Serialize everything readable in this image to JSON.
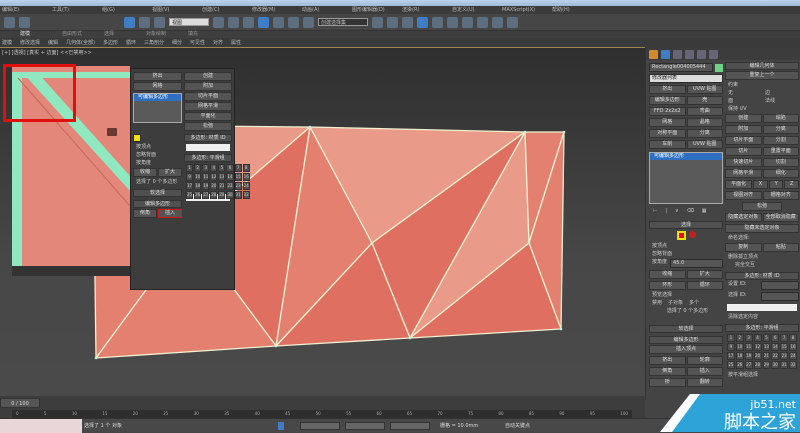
{
  "menu": [
    "编辑(E)",
    "工具(T)",
    "组(G)",
    "视图(V)",
    "创建(C)",
    "修改器(M)",
    "动画(A)",
    "图形编辑器(D)",
    "渲染(R)",
    "自定义(U)",
    "MAXScript(X)",
    "帮助(H)"
  ],
  "toolbar": {
    "view_select": "视图",
    "selection_set": "创建选择集"
  },
  "ribbon_tabs": [
    "建模",
    "自由形式",
    "选择",
    "对象绘制",
    "填充"
  ],
  "ribbon_items": [
    "建模",
    "修改选择",
    "编辑",
    "几何体(全部)",
    "多边形",
    "循环",
    "三角剖分",
    "细分",
    "可见性",
    "对齐",
    "属性"
  ],
  "viewport_label": "[+] [透视] [真实 + 边面] <<已禁用>>",
  "command_panel": {
    "object_name": "Rectangle004005444",
    "object_color": "#6fd08a",
    "modifier_list": "修改器列表",
    "left_buttons": [
      "挤出",
      "UVW 贴图",
      "编辑多边形",
      "壳",
      "FFD 2x2x2",
      "弯曲",
      "网格",
      "晶格",
      "对称平面",
      "分离",
      "车削",
      "UVW 贴图"
    ],
    "stack_item": "可编辑多边形",
    "selection_header": "选择",
    "selection_options": [
      "按顶点",
      "忽略背面",
      "按角度"
    ],
    "angle_value": "45.0",
    "shrink": "收缩",
    "grow": "扩大",
    "ring": "环形",
    "loop": "循环",
    "preview_label": "预览选择",
    "preview_options": [
      "禁用",
      "子对象",
      "多个"
    ],
    "selection_status": "选择了 0 个多边形",
    "soft_selection": "软选择",
    "edit_polygons": "编辑多边形",
    "insert_vertex": "插入顶点",
    "edit_buttons": [
      "挤出",
      "轮廓",
      "倒角",
      "插入",
      "桥",
      "翻转"
    ],
    "right_header": "编辑几何体",
    "repeat_last": "重复上一个",
    "constraints": "约束",
    "constraint_options": [
      "无",
      "边",
      "面",
      "法线"
    ],
    "preserve_uv": "保持 UV",
    "right_buttons": [
      "创建",
      "塌陷",
      "附加",
      "分离",
      "切片平面",
      "分割",
      "切片",
      "重置平面",
      "快速切片",
      "切割",
      "网格平滑",
      "细化",
      "平面化",
      "X",
      "Y",
      "Z",
      "视图对齐",
      "栅格对齐",
      "松弛",
      "隐藏选定对象",
      "全部取消隐藏",
      "隐藏未选定对象"
    ],
    "named_selections": "命名选择:",
    "copy": "复制",
    "paste": "粘贴",
    "delete_isolated": "删除孤立顶点",
    "full_interactivity": "完全交互",
    "material_header": "多边形: 材质 ID",
    "set_id": "设置 ID:",
    "select_id": "选择 ID:",
    "clear_selection": "清除选定内容",
    "smoothing_header": "多边形: 平滑组",
    "smoothing_groups": [
      "1",
      "2",
      "3",
      "4",
      "5",
      "6",
      "7",
      "8",
      "9",
      "10",
      "11",
      "12",
      "13",
      "14",
      "15",
      "16",
      "17",
      "18",
      "19",
      "20",
      "21",
      "22",
      "23",
      "24",
      "25",
      "26",
      "27",
      "28",
      "29",
      "30",
      "31",
      "32"
    ],
    "select_by_sg": "按平滑组选择"
  },
  "timeline": {
    "frame": "0 / 100",
    "ticks": [
      "0",
      "5",
      "10",
      "15",
      "20",
      "25",
      "30",
      "35",
      "40",
      "45",
      "50",
      "55",
      "60",
      "65",
      "70",
      "75",
      "80",
      "85",
      "90",
      "95",
      "100"
    ]
  },
  "status": {
    "message": "选择了 1 个 对象",
    "grid": "栅格 = 10.0mm",
    "autokey": "自动关键点"
  },
  "watermark": {
    "site": "jb51.net",
    "name": "脚本之家"
  },
  "colors": {
    "poly_face": "#e4806f",
    "poly_light": "#e99a88",
    "poly_dark": "#df6f60",
    "edge": "#f0efd0",
    "mint": "#8fe8c0",
    "highlight": "#e01010"
  }
}
